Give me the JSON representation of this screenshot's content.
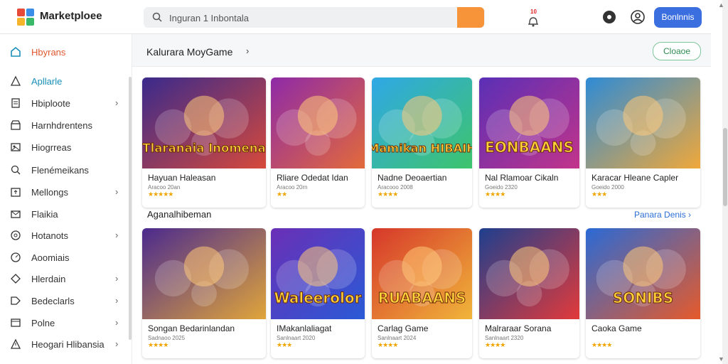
{
  "header": {
    "brand": "Marketploee",
    "search_placeholder": "Inguran 1 Inbontala",
    "notification_count": "10",
    "signin_label": "Bonlnnis"
  },
  "sidebar": {
    "home_label": "Hbyrans",
    "items": [
      {
        "label": "Apllarle",
        "icon": "triangle-icon",
        "chevron": false,
        "active": true
      },
      {
        "label": "Hbiploote",
        "icon": "document-icon",
        "chevron": true
      },
      {
        "label": "Harnhdrentens",
        "icon": "store-icon",
        "chevron": false
      },
      {
        "label": "Hiogrreas",
        "icon": "image-icon",
        "chevron": false
      },
      {
        "label": "Flenémeikans",
        "icon": "search-icon",
        "chevron": false
      },
      {
        "label": "Mellongs",
        "icon": "upload-icon",
        "chevron": true
      },
      {
        "label": "Flaikia",
        "icon": "mail-icon",
        "chevron": false
      },
      {
        "label": "Hotanots",
        "icon": "settings-icon",
        "chevron": true
      },
      {
        "label": "Aoomiais",
        "icon": "gauge-icon",
        "chevron": false
      },
      {
        "label": "Hlerdain",
        "icon": "shield-icon",
        "chevron": true
      },
      {
        "label": "Bedeclarls",
        "icon": "tag-icon",
        "chevron": true
      },
      {
        "label": "Polne",
        "icon": "window-icon",
        "chevron": true
      },
      {
        "label": "Heogari Hlibansia",
        "icon": "warning-icon",
        "chevron": true
      }
    ]
  },
  "main": {
    "breadcrumb": "Kalurara MoyGame",
    "top_button": "Cloaoe",
    "featured": {
      "cards": [
        {
          "title": "Hayuan Haleasan",
          "art_text": "Tlaranaia Inomena",
          "subtitle": "Aracoo 20an",
          "stars": "★★★★★",
          "art_colors": [
            "#3a2a8c",
            "#d6493b"
          ]
        },
        {
          "title": "Rliare Odedat Idan",
          "art_text": "",
          "subtitle": "Aracoo 20rn",
          "stars": "★★",
          "art_colors": [
            "#8e2aa8",
            "#e26a3a"
          ]
        },
        {
          "title": "Nadne Deoaertian",
          "art_text": "Mamikan HIBAIH",
          "subtitle": "Aracooo 2008",
          "stars": "★★★★",
          "art_colors": [
            "#2fa8e6",
            "#3ec46c"
          ]
        },
        {
          "title": "Nal Rlamoar Cikaln",
          "art_text": "EONBAANS",
          "subtitle": "Goeido 2320",
          "stars": "★★★★",
          "art_colors": [
            "#5a2fb6",
            "#c2348a"
          ]
        },
        {
          "title": "Karacar Hleane Capler",
          "art_text": "",
          "subtitle": "Goeido 2000",
          "stars": "★★★",
          "art_colors": [
            "#2e8bd6",
            "#f0a83a"
          ]
        }
      ]
    },
    "section2": {
      "title": "Aganalhibeman",
      "see_all": "Panara Denis",
      "cards": [
        {
          "title": "Songan Bedarinlandan",
          "art_text": "",
          "subtitle": "Sadnaoo 2025",
          "stars": "★★★★",
          "art_colors": [
            "#4b2a8e",
            "#e0a53a"
          ]
        },
        {
          "title": "IMakanlaliagat",
          "art_text": "Waleerolor",
          "subtitle": "Sanlnaart 2020",
          "stars": "★★★",
          "art_colors": [
            "#6a2fb6",
            "#2a5ad6"
          ]
        },
        {
          "title": "Carlag Game",
          "art_text": "RUABAANS",
          "subtitle": "Sanlnaart 2024",
          "stars": "★★★★",
          "art_colors": [
            "#d6372a",
            "#f0b53a"
          ]
        },
        {
          "title": "Malraraar Sorana",
          "art_text": "",
          "subtitle": "Sanlnaart 2320",
          "stars": "★★★★",
          "art_colors": [
            "#1e3f8e",
            "#e23a3a"
          ]
        },
        {
          "title": "Caoka Game",
          "art_text": "SONIBS",
          "subtitle": "",
          "stars": "★★★★",
          "art_colors": [
            "#2a6ad6",
            "#e65a2a"
          ]
        }
      ]
    }
  },
  "colors": {
    "accent_orange": "#f7943a",
    "primary_blue": "#3b6fe0",
    "home_orange": "#e0582e",
    "active_teal": "#1a8fb8",
    "star": "#f0a400"
  }
}
